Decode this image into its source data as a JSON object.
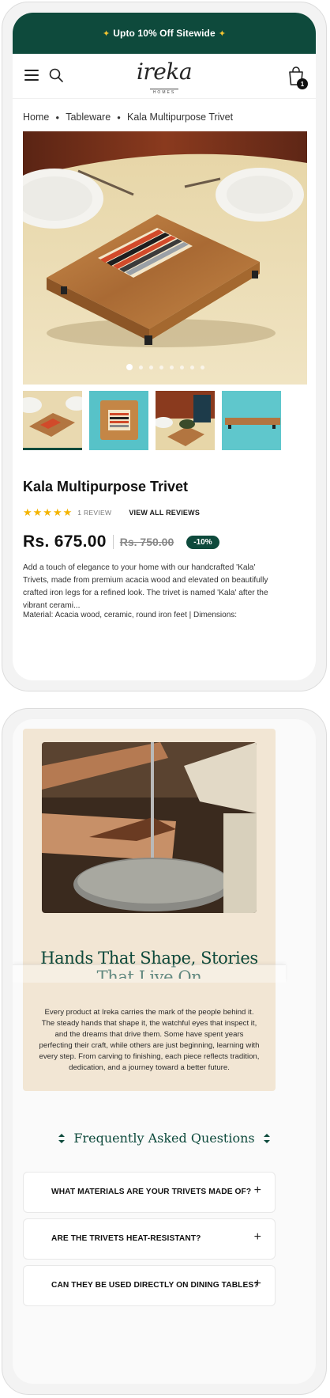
{
  "promo": {
    "text": "Upto 10% Off Sitewide",
    "star_left": "✦",
    "star_right": "✦"
  },
  "header": {
    "logo_text": "ireka",
    "logo_subtext": "HOMES",
    "cart_count": "1",
    "icons": [
      "menu-icon",
      "search-icon",
      "cart-icon"
    ]
  },
  "breadcrumb": {
    "items": [
      "Home",
      "Tableware",
      "Kala Multipurpose Trivet"
    ]
  },
  "gallery": {
    "slide_count": 8,
    "active_index": 0,
    "thumbnail_count": 4
  },
  "product": {
    "title": "Kala Multipurpose Trivet",
    "rating": 5,
    "review_count": "1 REVIEW",
    "view_all_reviews": "VIEW ALL REVIEWS",
    "price": "Rs. 675.00",
    "compare_price": "Rs. 750.00",
    "discount_badge": "-10%",
    "description": "Add a touch of elegance to your home with our handcrafted 'Kala' Trivets, made from premium acacia wood and elevated on beautifully crafted iron legs for a refined look. The trivet is named 'Kala' after the vibrant cerami...",
    "details_partial": "Material: Acacia wood, ceramic, round iron feet | Dimensions:"
  },
  "craft": {
    "title_line1": "Hands That Shape, Stories",
    "title_line2": "That Live On",
    "body": "Every product at Ireka carries the mark of the people behind it. The steady hands that shape it, the watchful eyes that inspect it, and the dreams that drive them. Some have spent years perfecting their craft, while others are just beginning, learning with every step. From carving to finishing, each piece reflects tradition, dedication, and a journey toward a better future."
  },
  "faq": {
    "title": "Frequently Asked Questions",
    "items": [
      {
        "question": "WHAT MATERIALS ARE YOUR TRIVETS MADE OF?",
        "icon": "+"
      },
      {
        "question": "ARE THE TRIVETS HEAT-RESISTANT?",
        "icon": "+"
      },
      {
        "question": "CAN THEY BE USED DIRECTLY ON DINING TABLES?",
        "icon": "+"
      }
    ]
  },
  "colors": {
    "brand_green": "#0e4a3c",
    "star_yellow": "#f4b400",
    "craft_background": "#f2e6d4"
  }
}
